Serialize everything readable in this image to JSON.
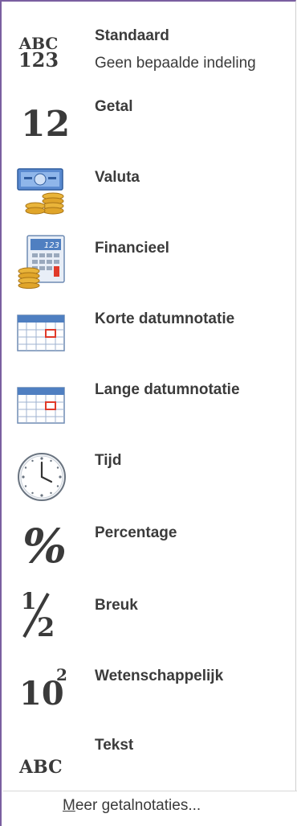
{
  "menu": {
    "items": [
      {
        "icon": "abc-123-icon",
        "label": "Standaard",
        "description": "Geen bepaalde indeling",
        "glyph_top": "ABC",
        "glyph_bottom": "123"
      },
      {
        "icon": "number-icon",
        "label": "Getal",
        "glyph": "12"
      },
      {
        "icon": "currency-icon",
        "label": "Valuta"
      },
      {
        "icon": "accounting-icon",
        "label": "Financieel",
        "glyph": "123"
      },
      {
        "icon": "calendar-icon",
        "label": "Korte datumnotatie"
      },
      {
        "icon": "calendar-icon",
        "label": "Lange datumnotatie"
      },
      {
        "icon": "clock-icon",
        "label": "Tijd"
      },
      {
        "icon": "percent-icon",
        "label": "Percentage",
        "glyph": "%"
      },
      {
        "icon": "fraction-icon",
        "label": "Breuk",
        "glyph_num": "1",
        "glyph_den": "2"
      },
      {
        "icon": "scientific-icon",
        "label": "Wetenschappelijk",
        "glyph_base": "10",
        "glyph_exp": "2"
      },
      {
        "icon": "text-icon",
        "label": "Tekst",
        "glyph": "ABC"
      }
    ],
    "footer": {
      "accelerator": "M",
      "label_rest": "eer getalnotaties..."
    }
  },
  "colors": {
    "border_accent": "#7a5fa0",
    "text": "#3b3b3b",
    "calendar_blue": "#4f7fc1",
    "calendar_red": "#e03a2a",
    "coin_gold": "#e0a52a"
  }
}
